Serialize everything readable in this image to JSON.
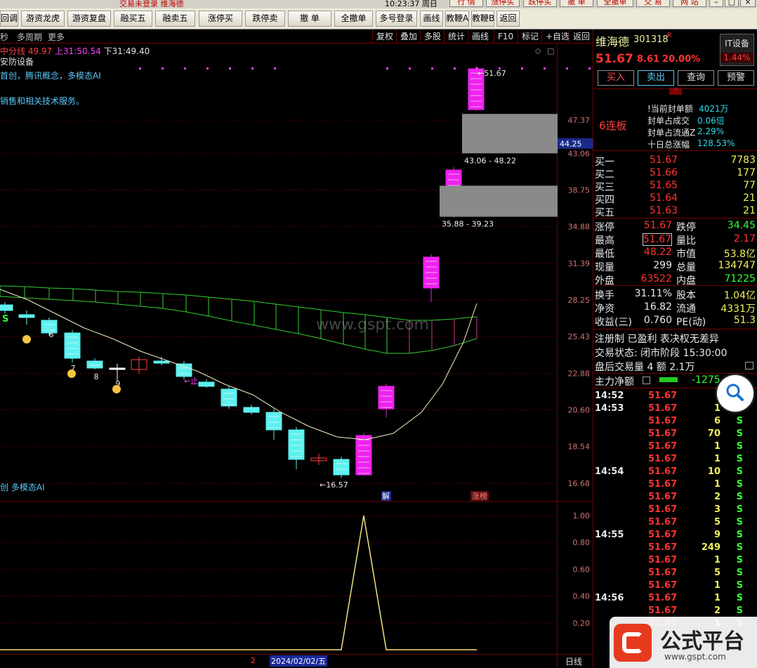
{
  "topbar": {
    "status": "交易未登录  维海德",
    "time": "10:23:37 周日",
    "buttons": [
      "行 情",
      "涨停买",
      "跌停买",
      "撤 单",
      "全撤单",
      "交 易",
      "网 站"
    ]
  },
  "toolbar": {
    "buttons": [
      "回调",
      "游资龙虎",
      "游资复盘",
      "融买五",
      "融卖五",
      "涨停买",
      "跌停卖",
      "撤 单",
      "全撤单",
      "多号登录",
      "画线",
      "教鞭A",
      "教鞭B",
      "返回"
    ]
  },
  "subbar": {
    "left": [
      "秒",
      "多周期",
      "更多"
    ],
    "right": [
      "复权",
      "叠加",
      "多股",
      "统计",
      "画线",
      "F10",
      "标记",
      "+自选",
      "返回"
    ]
  },
  "chart_info": {
    "ma_label": "中分线",
    "ma_value": "49.97",
    "up_label": "上31:",
    "up_value": "50.54",
    "down_label": "下31:",
    "down_value": "49.40",
    "industry": "安防设备",
    "concepts": "首创，腾讯概念，多模态AI",
    "business": "销售和相关技术服务。",
    "bottom_note": "创 多模态AI"
  },
  "chart_data": {
    "type": "candlestick",
    "y_ticks": [
      "47.37",
      "43.06",
      "38.75",
      "34.88",
      "31.39",
      "28.25",
      "25.43",
      "22.88",
      "20.60",
      "18.54",
      "16.68"
    ],
    "current_price_tag": "44.25",
    "high_label": "51.67",
    "low_label": "16.57",
    "gap_labels": [
      "43.06 - 48.22",
      "35.88 - 39.23"
    ],
    "day_labels": [
      "6",
      "7",
      "8",
      "9"
    ],
    "markers": {
      "s": "S",
      "zhi": "止",
      "jie": "解",
      "zhangting": "涨榜"
    },
    "indicator_ticks": [
      "1.00",
      "0.80",
      "0.60",
      "0.40",
      "0.20"
    ],
    "date_label": "2024/02/02/五",
    "period_label": "日线",
    "small_num": "2"
  },
  "right": {
    "name": "维海德",
    "code": "301318",
    "flag": "R",
    "price": "51.67",
    "change": "8.61",
    "percent": "20.00%",
    "sector": "IT设备",
    "sector_pct": "1.44%",
    "buttons": [
      "买入",
      "卖出",
      "查询",
      "预警"
    ],
    "streak": "6连板",
    "seal": [
      {
        "k": "当前封单额",
        "v": "4021万"
      },
      {
        "k": "封单占成交",
        "v": "0.06倍"
      },
      {
        "k": "封单占流通Z",
        "v": "2.29%"
      },
      {
        "k": "十日总涨幅",
        "v": "128.53%"
      }
    ],
    "buy": [
      {
        "k": "买一",
        "p": "51.67",
        "v": "7783"
      },
      {
        "k": "买二",
        "p": "51.66",
        "v": "177"
      },
      {
        "k": "买三",
        "p": "51.65",
        "v": "77"
      },
      {
        "k": "买四",
        "p": "51.64",
        "v": "21"
      },
      {
        "k": "买五",
        "p": "51.63",
        "v": "21"
      }
    ],
    "stats1": [
      {
        "k": "涨停",
        "v": "51.67",
        "k2": "跌停",
        "v2": "34.45"
      },
      {
        "k": "最高",
        "v": "51.67",
        "k2": "量比",
        "v2": "2.17"
      },
      {
        "k": "最低",
        "v": "48.22",
        "k2": "市值",
        "v2": "53.8亿"
      },
      {
        "k": "现量",
        "v": "299",
        "k2": "总量",
        "v2": "134747"
      },
      {
        "k": "外盘",
        "v": "63522",
        "k2": "内盘",
        "v2": "71225"
      }
    ],
    "stats2": [
      {
        "k": "换手",
        "v": "31.11%",
        "k2": "股本",
        "v2": "1.04亿"
      },
      {
        "k": "净资",
        "v": "16.82",
        "k2": "流通",
        "v2": "4331万"
      },
      {
        "k": "收益(三)",
        "v": "0.760",
        "k2": "PE(动)",
        "v2": "51.3"
      }
    ],
    "lines": [
      "注册制 已盈利 表决权无差异",
      "交易状态: 闭市阶段 15:30:00",
      "盘后交易量 4 额 2.1万"
    ],
    "flow_label": "主力净额",
    "flow_value": "-1275",
    "ticks": [
      {
        "t": "14:52",
        "p": "51.67",
        "v": "",
        "s": ""
      },
      {
        "t": "14:53",
        "p": "51.67",
        "v": "1",
        "s": "S"
      },
      {
        "t": "",
        "p": "51.67",
        "v": "6",
        "s": "S"
      },
      {
        "t": "",
        "p": "51.67",
        "v": "70",
        "s": "S"
      },
      {
        "t": "",
        "p": "51.67",
        "v": "1",
        "s": "S"
      },
      {
        "t": "",
        "p": "51.67",
        "v": "1",
        "s": "S"
      },
      {
        "t": "14:54",
        "p": "51.67",
        "v": "10",
        "s": "S"
      },
      {
        "t": "",
        "p": "51.67",
        "v": "1",
        "s": "S"
      },
      {
        "t": "",
        "p": "51.67",
        "v": "2",
        "s": "S"
      },
      {
        "t": "",
        "p": "51.67",
        "v": "3",
        "s": "S"
      },
      {
        "t": "",
        "p": "51.67",
        "v": "5",
        "s": "S"
      },
      {
        "t": "14:55",
        "p": "51.67",
        "v": "9",
        "s": "S"
      },
      {
        "t": "",
        "p": "51.67",
        "v": "249",
        "s": "S"
      },
      {
        "t": "",
        "p": "51.67",
        "v": "1",
        "s": "S"
      },
      {
        "t": "",
        "p": "51.67",
        "v": "5",
        "s": "S"
      },
      {
        "t": "",
        "p": "51.67",
        "v": "1",
        "s": "S"
      },
      {
        "t": "14:56",
        "p": "51.67",
        "v": "1",
        "s": "S"
      },
      {
        "t": "",
        "p": "51.67",
        "v": "2",
        "s": "S"
      },
      {
        "t": "",
        "p": "51.67",
        "v": "1",
        "s": "S"
      }
    ]
  },
  "watermark": {
    "site": "www.gspt.com",
    "brand": "公式平台",
    "brand_url": "www.gspt.com"
  }
}
